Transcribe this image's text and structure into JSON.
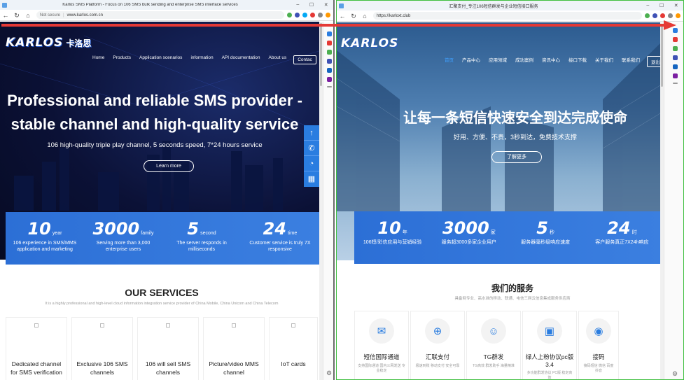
{
  "left": {
    "tab_title": "Karlos SMS Platform - Focus on 106 SMS bulk sending and enterprise SMS interface services",
    "address": {
      "security": "Not secure",
      "url": "www.karlos.com.cn"
    },
    "logo": {
      "text": "KARLOS",
      "cn": "卡洛思"
    },
    "menu": [
      "Home",
      "Products",
      "Application scenarios",
      "information",
      "API documentation",
      "About us",
      "Contac"
    ],
    "hero": {
      "line1": "Professional and reliable SMS provider -",
      "line2": "stable channel and high-quality service",
      "subtitle": "106 high-quality triple play channel, 5 seconds speed, 7*24 hours service",
      "button": "Learn more"
    },
    "stats": [
      {
        "num": "10",
        "unit": "year",
        "desc": "106 experience in SMS/MMS application and marketing"
      },
      {
        "num": "3000",
        "unit": "family",
        "desc": "Serving more than 3,000 enterprise users"
      },
      {
        "num": "5",
        "unit": "second",
        "desc": "The server responds in milliseconds"
      },
      {
        "num": "24",
        "unit": "time",
        "desc": "Customer service is truly 7X responsive"
      }
    ],
    "services": {
      "title": "OUR SERVICES",
      "subtitle": "It is a highly professional and high-level cloud information integration service provider of China Mobile, China Unicom and China Telecom",
      "cards": [
        "Dedicated channel for SMS verification",
        "Exclusive 106 SMS channels",
        "106 will sell SMS channels",
        "Picture/video MMS channel",
        "IoT cards"
      ]
    },
    "float_icons": [
      "arrow-up",
      "phone",
      "chat",
      "qr-code"
    ]
  },
  "right": {
    "tab_title": "汇聚支付_专注106短信群发与企业短信接口服务",
    "address": {
      "url": "https://karloxt.club"
    },
    "logo": {
      "text": "KARLOS"
    },
    "menu": [
      "首页",
      "产品中心",
      "应用领域",
      "成功案例",
      "资讯中心",
      "接口下载",
      "关于我们",
      "联系我们",
      "退出"
    ],
    "hero": {
      "line1": "让每一条短信快速安全到达完成使命",
      "subtitle": "好用、方便、不贵，3秒到达，免费技术支撑",
      "button": "了解更多"
    },
    "stats": [
      {
        "num": "10",
        "unit": "年",
        "desc": "106短/彩信应用与营销经验"
      },
      {
        "num": "3000",
        "unit": "家",
        "desc": "服务超3000多家企业用户"
      },
      {
        "num": "5",
        "unit": "秒",
        "desc": "服务器毫秒级响应速度"
      },
      {
        "num": "24",
        "unit": "时",
        "desc": "客户服务真正7X24h响应"
      }
    ],
    "services": {
      "title": "我们的服务",
      "subtitle": "具备网专业、高水准的移动、联通、电信三网云信息集成服务供应商",
      "cards": [
        {
          "label": "短信国际通道",
          "desc": "支持国际通道 国内三网发送 专业稳定"
        },
        {
          "label": "汇联支付",
          "desc": "极速到账 移动支付 安全可靠"
        },
        {
          "label": "TG群发",
          "desc": "TG高效 群发助手 海量精准"
        },
        {
          "label": "绿人上粉协议pc版3.4",
          "desc": "多功能群发协议 PC版 稳定高效"
        },
        {
          "label": "接码",
          "desc": "接码短信 微信 百度 抖音"
        }
      ]
    }
  },
  "colors": {
    "accent": "#2a7de0",
    "arrow": "#e53935",
    "stats_bg": "#2c6fd6"
  }
}
